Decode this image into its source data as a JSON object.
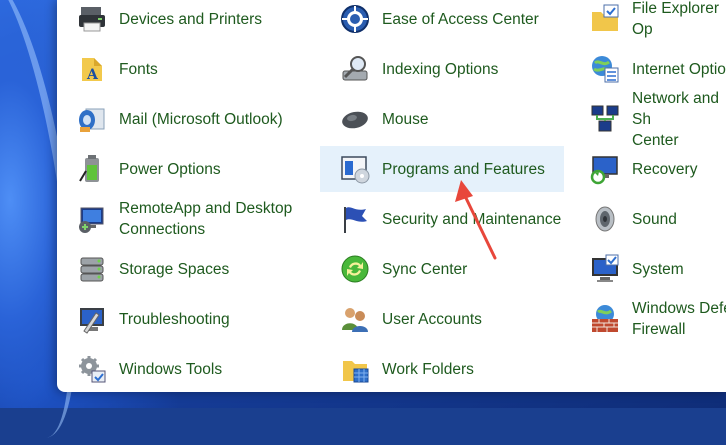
{
  "items": [
    {
      "label": "Devices and Printers",
      "icon": "printer-icon"
    },
    {
      "label": "Ease of Access Center",
      "icon": "ease-of-access-icon"
    },
    {
      "label": "File Explorer Op",
      "icon": "file-explorer-options-icon"
    },
    {
      "label": "Fonts",
      "icon": "fonts-icon"
    },
    {
      "label": "Indexing Options",
      "icon": "indexing-options-icon"
    },
    {
      "label": "Internet Option",
      "icon": "internet-options-icon"
    },
    {
      "label": "Mail (Microsoft Outlook)",
      "icon": "mail-icon"
    },
    {
      "label": "Mouse",
      "icon": "mouse-icon"
    },
    {
      "label": "Network and Sh\nCenter",
      "icon": "network-icon"
    },
    {
      "label": "Power Options",
      "icon": "battery-icon"
    },
    {
      "label": "Programs and Features",
      "icon": "programs-features-icon",
      "selected": true
    },
    {
      "label": "Recovery",
      "icon": "recovery-icon"
    },
    {
      "label": "RemoteApp and Desktop\nConnections",
      "icon": "remoteapp-icon"
    },
    {
      "label": "Security and Maintenance",
      "icon": "security-flag-icon"
    },
    {
      "label": "Sound",
      "icon": "speaker-icon"
    },
    {
      "label": "Storage Spaces",
      "icon": "storage-spaces-icon"
    },
    {
      "label": "Sync Center",
      "icon": "sync-center-icon"
    },
    {
      "label": "System",
      "icon": "system-icon"
    },
    {
      "label": "Troubleshooting",
      "icon": "troubleshooting-icon"
    },
    {
      "label": "User Accounts",
      "icon": "user-accounts-icon"
    },
    {
      "label": "Windows Defe\nFirewall",
      "icon": "firewall-icon"
    },
    {
      "label": "Windows Tools",
      "icon": "windows-tools-icon"
    },
    {
      "label": "Work Folders",
      "icon": "work-folders-icon"
    }
  ],
  "colors": {
    "label": "#1e5a1e",
    "selected_bg": "#e5f1fb",
    "annotation_arrow": "#e8473b"
  }
}
